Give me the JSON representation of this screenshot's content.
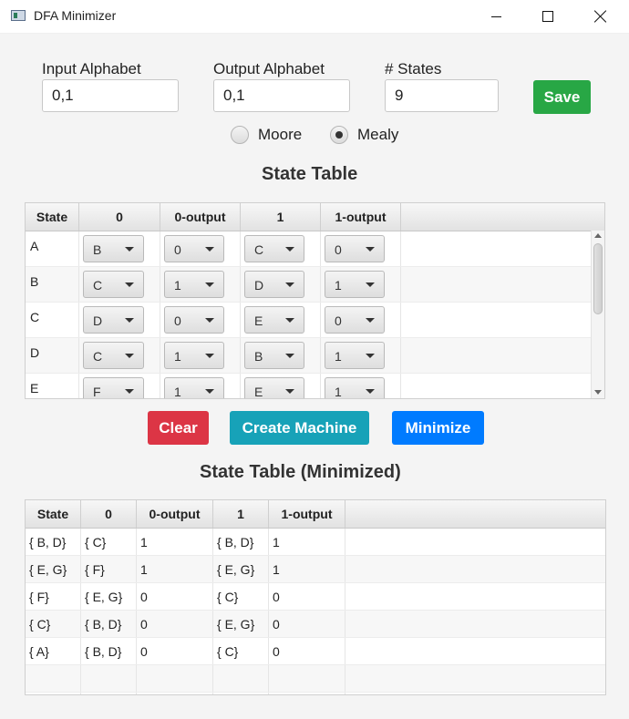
{
  "window": {
    "title": "DFA Minimizer"
  },
  "settings": {
    "input_alphabet_label": "Input Alphabet",
    "input_alphabet_value": "0,1",
    "output_alphabet_label": "Output Alphabet",
    "output_alphabet_value": "0,1",
    "states_label": "# States",
    "states_value": "9",
    "save_label": "Save",
    "machine_types": [
      "Moore",
      "Mealy"
    ],
    "selected_type": "Mealy"
  },
  "state_table": {
    "title": "State Table",
    "columns": [
      "State",
      "0",
      "0-output",
      "1",
      "1-output"
    ],
    "rows": [
      {
        "state": "A",
        "next0": "B",
        "out0": "0",
        "next1": "C",
        "out1": "0"
      },
      {
        "state": "B",
        "next0": "C",
        "out0": "1",
        "next1": "D",
        "out1": "1"
      },
      {
        "state": "C",
        "next0": "D",
        "out0": "0",
        "next1": "E",
        "out1": "0"
      },
      {
        "state": "D",
        "next0": "C",
        "out0": "1",
        "next1": "B",
        "out1": "1"
      },
      {
        "state": "E",
        "next0": "F",
        "out0": "1",
        "next1": "E",
        "out1": "1"
      }
    ]
  },
  "actions": {
    "clear": "Clear",
    "create_machine": "Create Machine",
    "minimize": "Minimize"
  },
  "minimized_table": {
    "title": "State Table (Minimized)",
    "columns": [
      "State",
      "0",
      "0-output",
      "1",
      "1-output"
    ],
    "rows": [
      {
        "state": "{ B, D}",
        "next0": "{ C}",
        "out0": "1",
        "next1": "{ B, D}",
        "out1": "1"
      },
      {
        "state": "{ E, G}",
        "next0": "{ F}",
        "out0": "1",
        "next1": "{ E, G}",
        "out1": "1"
      },
      {
        "state": "{ F}",
        "next0": "{ E, G}",
        "out0": "0",
        "next1": "{ C}",
        "out1": "0"
      },
      {
        "state": "{ C}",
        "next0": "{ B, D}",
        "out0": "0",
        "next1": "{ E, G}",
        "out1": "0"
      },
      {
        "state": "{ A}",
        "next0": "{ B, D}",
        "out0": "0",
        "next1": "{ C}",
        "out1": "0"
      }
    ]
  },
  "colors": {
    "save": "#28a745",
    "clear": "#dc3545",
    "create_machine": "#17a2b8",
    "minimize": "#007bff"
  }
}
